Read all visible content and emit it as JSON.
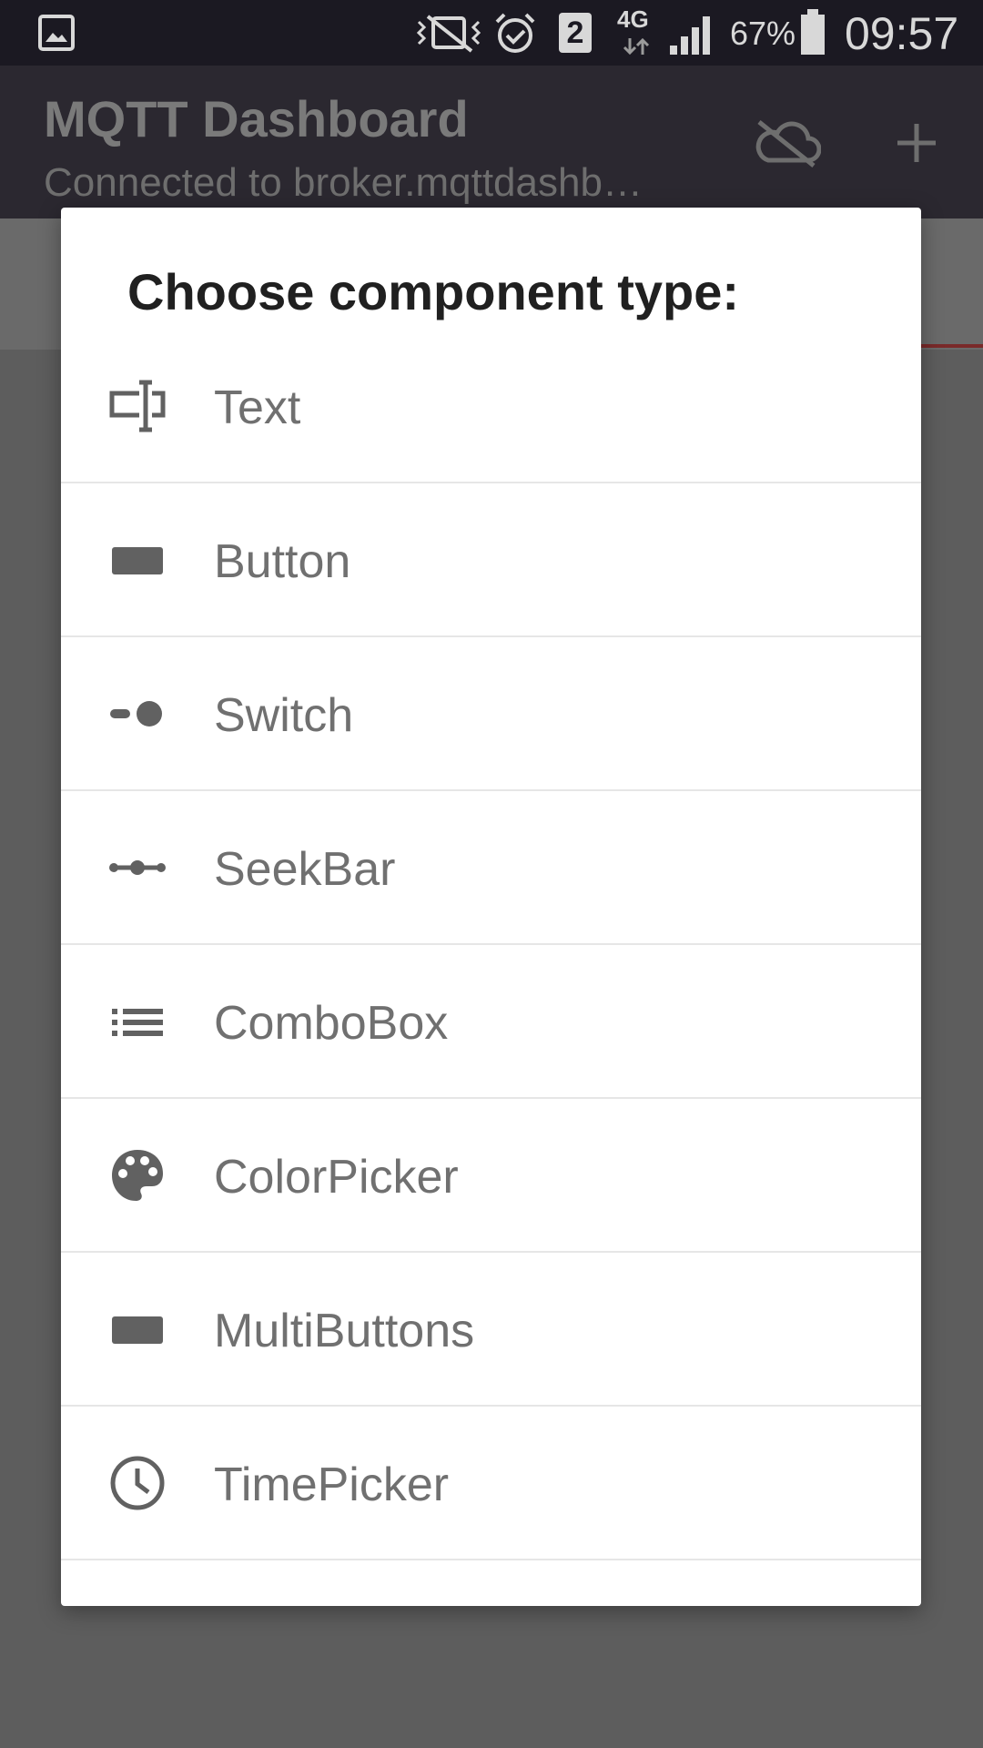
{
  "status_bar": {
    "sim_slot": "2",
    "network": "4G",
    "battery_percent": "67%",
    "time": "09:57"
  },
  "app_bar": {
    "title": "MQTT Dashboard",
    "subtitle": "Connected to broker.mqttdashb…"
  },
  "dialog": {
    "title": "Choose component type:",
    "items": [
      {
        "label": "Text",
        "icon": "text-field-icon"
      },
      {
        "label": "Button",
        "icon": "button-icon"
      },
      {
        "label": "Switch",
        "icon": "switch-icon"
      },
      {
        "label": "SeekBar",
        "icon": "seekbar-icon"
      },
      {
        "label": "ComboBox",
        "icon": "list-icon"
      },
      {
        "label": "ColorPicker",
        "icon": "palette-icon"
      },
      {
        "label": "MultiButtons",
        "icon": "button-icon"
      },
      {
        "label": "TimePicker",
        "icon": "clock-icon"
      }
    ]
  },
  "colors": {
    "status_bar_bg": "#1b1922",
    "app_bar_bg": "#2b2830",
    "overlay_bg": "#5d5d5d",
    "dialog_bg": "#ffffff",
    "icon_gray": "#616161",
    "label_gray": "#707070"
  }
}
